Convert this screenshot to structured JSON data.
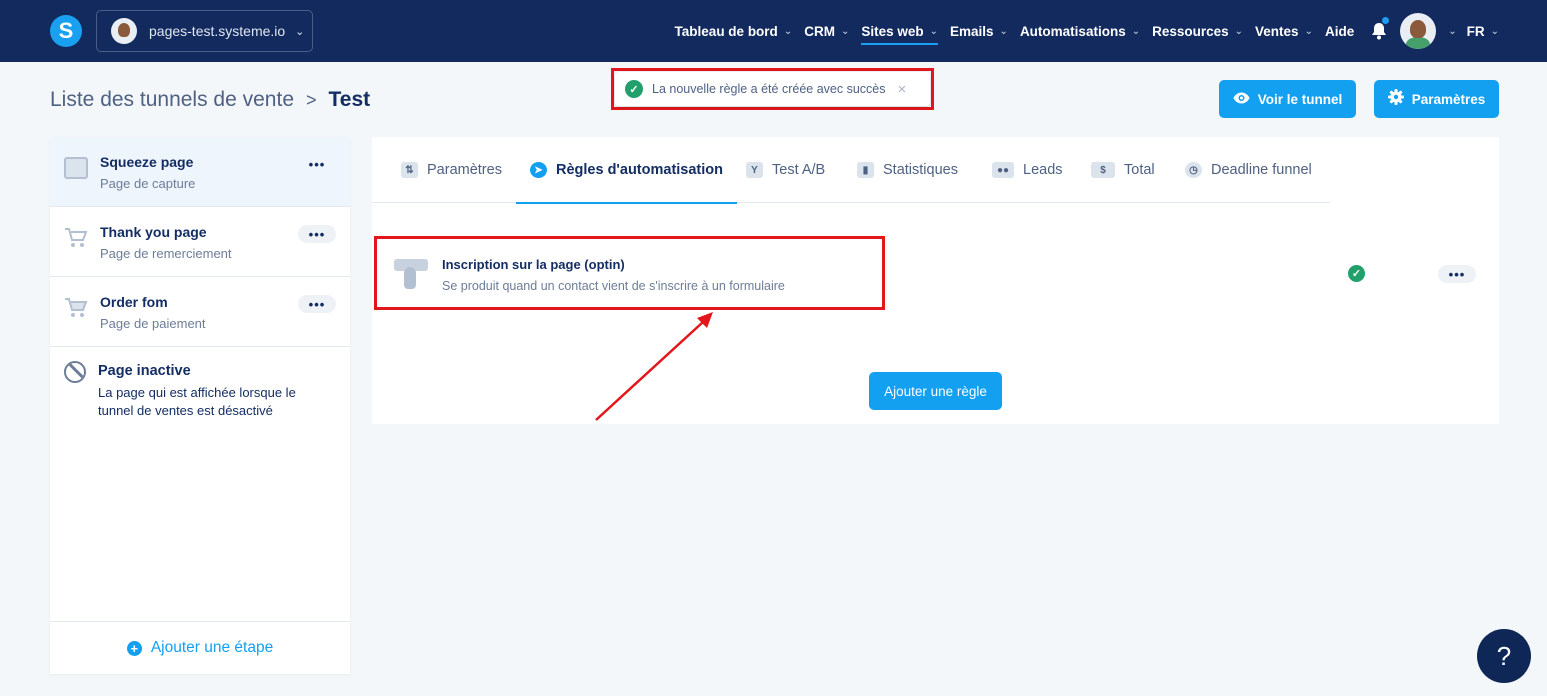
{
  "topbar": {
    "logo": "S",
    "site": "pages-test.systeme.io",
    "nav": [
      {
        "label": "Tableau de bord",
        "chevron": true
      },
      {
        "label": "CRM",
        "chevron": true
      },
      {
        "label": "Sites web",
        "chevron": true
      },
      {
        "label": "Emails",
        "chevron": true
      },
      {
        "label": "Automatisations",
        "chevron": true
      },
      {
        "label": "Ressources",
        "chevron": true
      },
      {
        "label": "Ventes",
        "chevron": true
      },
      {
        "label": "Aide",
        "chevron": false
      }
    ],
    "language": "FR"
  },
  "breadcrumb": {
    "parent": "Liste des tunnels de vente",
    "separator": ">",
    "current": "Test"
  },
  "toast": {
    "message": "La nouvelle règle a été créée avec succès",
    "close": "×"
  },
  "header_buttons": {
    "view": "Voir le tunnel",
    "settings": "Paramètres"
  },
  "steps": [
    {
      "title": "Squeeze page",
      "subtitle": "Page de capture",
      "menu": "•••"
    },
    {
      "title": "Thank you page",
      "subtitle": "Page de remerciement",
      "menu": "•••"
    },
    {
      "title": "Order fom",
      "subtitle": "Page de paiement",
      "menu": "•••"
    }
  ],
  "inactive_page": {
    "title": "Page inactive",
    "description": "La page qui est affichée lorsque le tunnel de ventes est désactivé"
  },
  "add_step": "Ajouter une étape",
  "tabs": [
    {
      "label": "Paramètres",
      "icon": "sliders-icon"
    },
    {
      "label": "Règles d'automatisation",
      "icon": "bolt-icon"
    },
    {
      "label": "Test A/B",
      "icon": "split-icon"
    },
    {
      "label": "Statistiques",
      "icon": "chart-icon"
    },
    {
      "label": "Leads",
      "icon": "people-icon"
    },
    {
      "label": "Total",
      "icon": "dollar-icon"
    },
    {
      "label": "Deadline funnel",
      "icon": "clock-icon"
    }
  ],
  "rule": {
    "title": "Inscription sur la page (optin)",
    "description": "Se produit quand un contact vient de s'inscrire à un formulaire",
    "menu": "•••"
  },
  "add_rule": "Ajouter une règle",
  "help": "?",
  "colors": {
    "navy": "#132a5e",
    "accent": "#13a0f0",
    "success": "#22a06b",
    "highlight": "#e3171b"
  }
}
